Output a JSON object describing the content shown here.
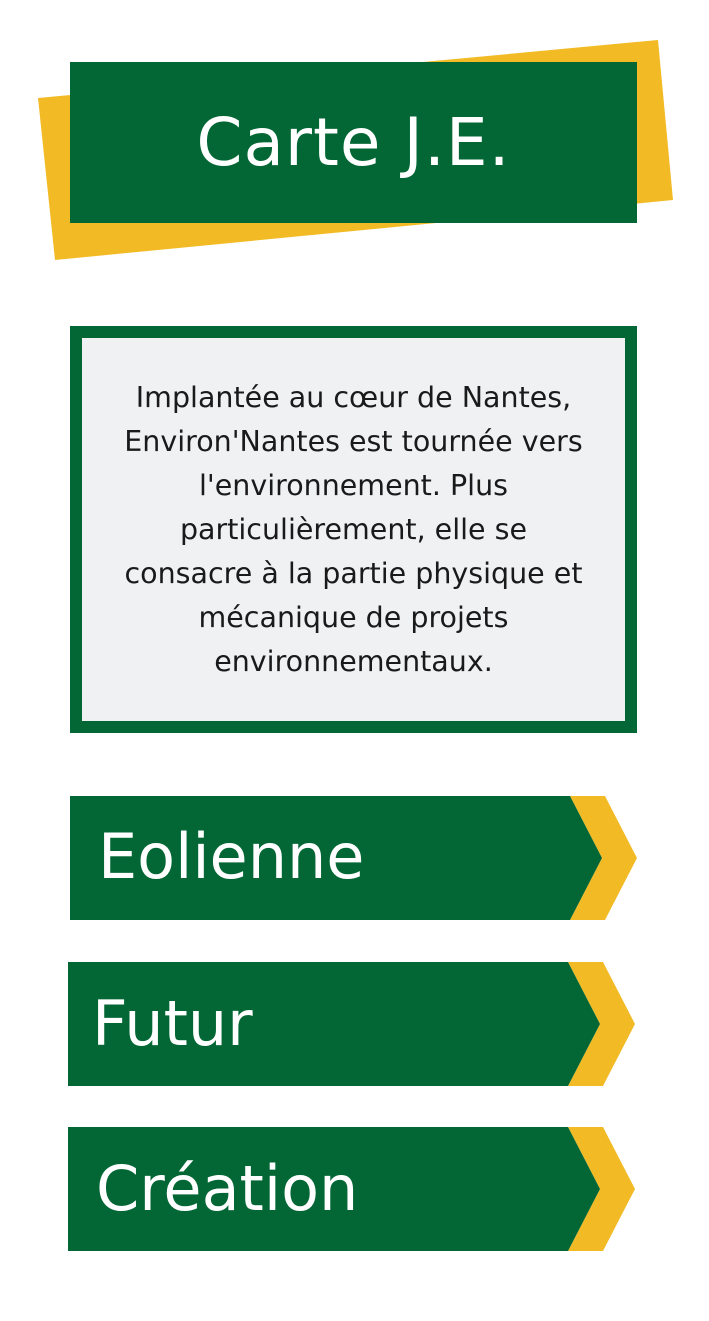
{
  "colors": {
    "green": "#036735",
    "yellow": "#f2bb26",
    "panel": "#f0f1f3",
    "text_dark": "#1a1a1a",
    "text_light": "#ffffff"
  },
  "header": {
    "title": "Carte J.E."
  },
  "description": {
    "text": "Implantée au cœur de Nantes,\nEnviron'Nantes est tournée vers\nl'environnement. Plus\nparticulièrement, elle se\nconsacre à la partie physique et\nmécanique de projets\nenvironnementaux."
  },
  "menu": {
    "items": [
      {
        "label": "Eolienne",
        "icon": "chevron-right-icon"
      },
      {
        "label": "Futur",
        "icon": "chevron-right-icon"
      },
      {
        "label": "Création",
        "icon": "chevron-right-icon"
      }
    ]
  }
}
